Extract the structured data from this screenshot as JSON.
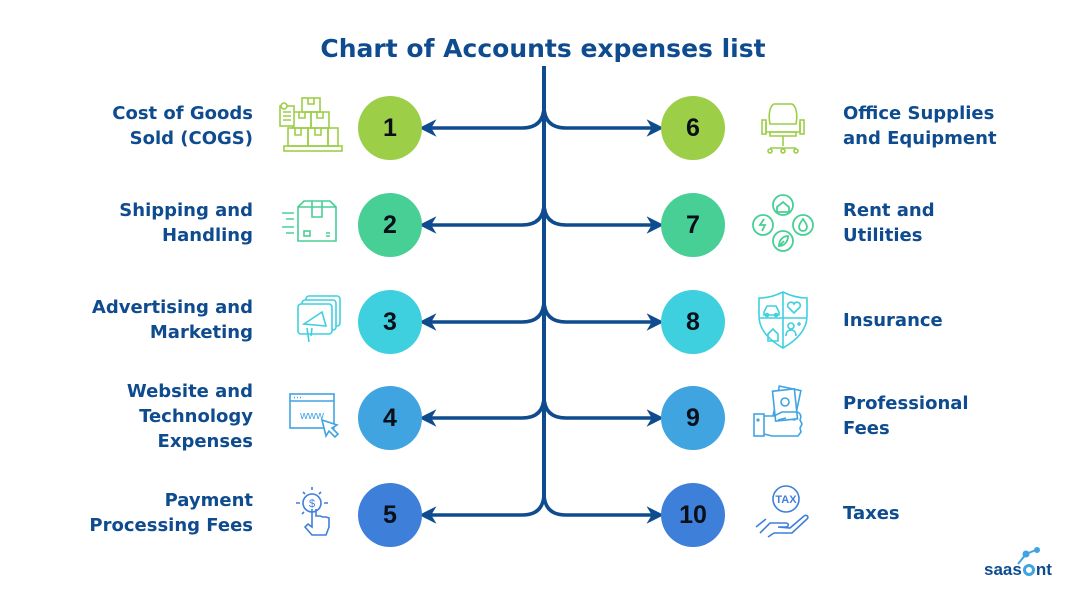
{
  "title": "Chart of Accounts expenses list",
  "items": [
    {
      "number": "1",
      "label_line1": "Cost of Goods",
      "label_line2": "Sold (COGS)",
      "icon": "boxes-icon",
      "color": "#9cce48"
    },
    {
      "number": "2",
      "label_line1": "Shipping and",
      "label_line2": "Handling",
      "icon": "shipping-box-icon",
      "color": "#48cf96"
    },
    {
      "number": "3",
      "label_line1": "Advertising and",
      "label_line2": "Marketing",
      "icon": "megaphone-icon",
      "color": "#3fd0df"
    },
    {
      "number": "4",
      "label_line1": "Website and",
      "label_line2": "Technology",
      "label_line3": "Expenses",
      "icon": "website-icon",
      "color": "#40a4e1"
    },
    {
      "number": "5",
      "label_line1": "Payment",
      "label_line2": "Processing Fees",
      "icon": "payment-tap-icon",
      "color": "#3e7fda"
    },
    {
      "number": "6",
      "label_line1": "Office Supplies",
      "label_line2": "and Equipment",
      "icon": "office-chair-icon",
      "color": "#9cce48"
    },
    {
      "number": "7",
      "label_line1": "Rent and",
      "label_line2": "Utilities",
      "icon": "utilities-icon",
      "color": "#48cf96"
    },
    {
      "number": "8",
      "label_line1": "Insurance",
      "icon": "insurance-shield-icon",
      "color": "#3fd0df"
    },
    {
      "number": "9",
      "label_line1": "Professional",
      "label_line2": "Fees",
      "icon": "money-hand-icon",
      "color": "#40a4e1"
    },
    {
      "number": "10",
      "label_line1": "Taxes",
      "icon": "tax-hand-icon",
      "color": "#3e7fda"
    }
  ],
  "line_color": "#0e4b8f",
  "logo": {
    "text_a": "saas",
    "text_b": "nt"
  }
}
